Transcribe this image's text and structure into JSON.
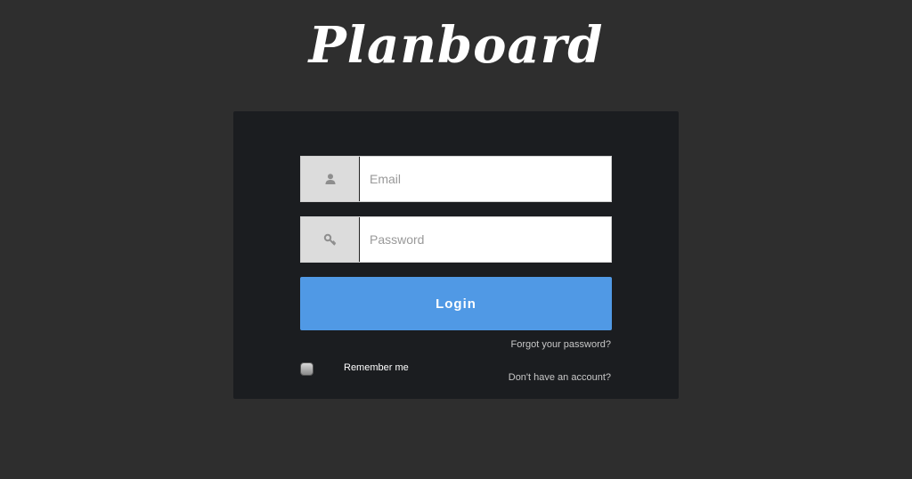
{
  "app": {
    "logo_text": "Planboard"
  },
  "form": {
    "email": {
      "placeholder": "Email",
      "value": "",
      "icon": "user-icon"
    },
    "password": {
      "placeholder": "Password",
      "value": "",
      "icon": "key-icon"
    },
    "login_label": "Login",
    "forgot_label": "Forgot your password?",
    "remember_label": "Remember me",
    "remember_checked": false,
    "signup_label": "Don't have an account?"
  },
  "colors": {
    "background": "#2e2e2e",
    "card": "#1b1d20",
    "accent": "#5099e5",
    "addon": "#dcdcdc"
  }
}
